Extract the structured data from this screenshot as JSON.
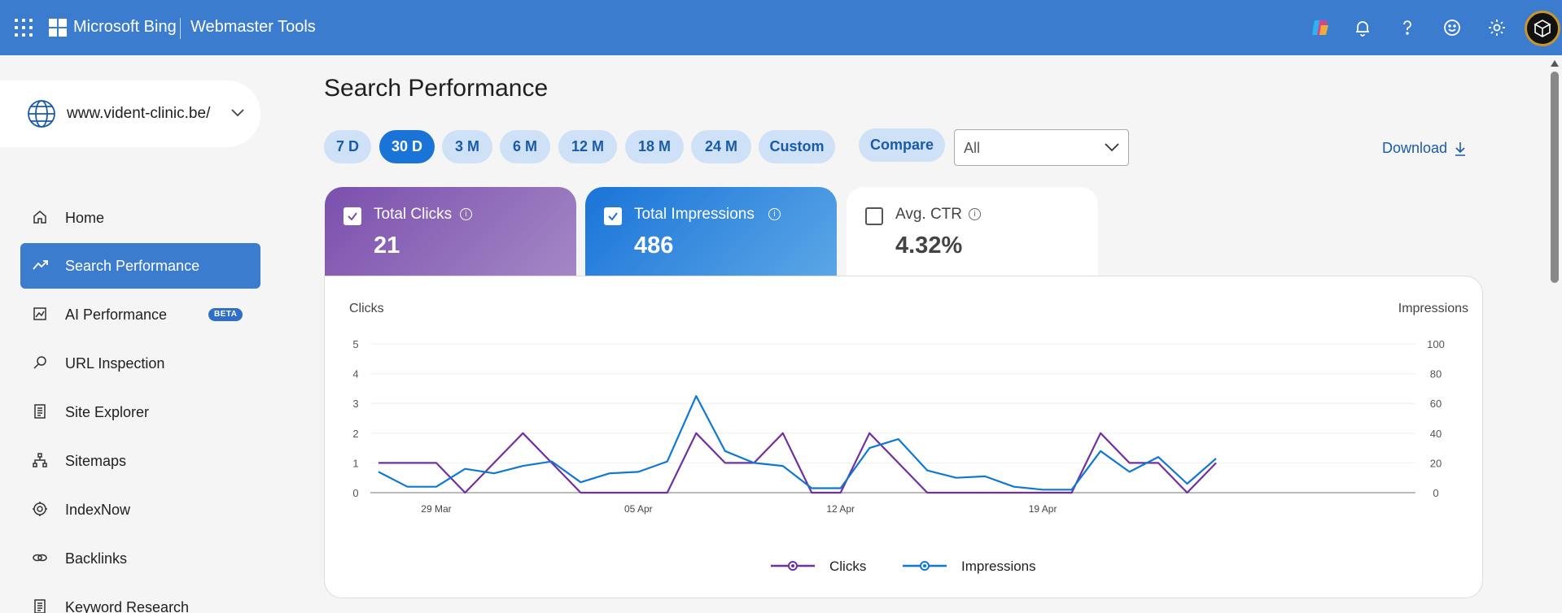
{
  "header": {
    "brand": "Microsoft Bing",
    "product": "Webmaster Tools",
    "icons": [
      "apps-icon",
      "copilot-icon",
      "bell-icon",
      "help-icon",
      "feedback-smiley-icon",
      "settings-gear-icon",
      "avatar"
    ]
  },
  "sidebar": {
    "site": "www.vident-clinic.be/",
    "items": [
      {
        "label": "Home",
        "icon": "home-icon"
      },
      {
        "label": "Search Performance",
        "icon": "trend-icon",
        "active": true
      },
      {
        "label": "AI Performance",
        "icon": "image-chart-icon",
        "badge": "BETA"
      },
      {
        "label": "URL Inspection",
        "icon": "search-icon"
      },
      {
        "label": "Site Explorer",
        "icon": "document-icon"
      },
      {
        "label": "Sitemaps",
        "icon": "sitemap-icon"
      },
      {
        "label": "IndexNow",
        "icon": "gear-icon"
      },
      {
        "label": "Backlinks",
        "icon": "link-icon"
      },
      {
        "label": "Keyword Research",
        "icon": "document-icon"
      }
    ]
  },
  "main": {
    "title": "Search Performance",
    "ranges": [
      "7 D",
      "30 D",
      "3 M",
      "6 M",
      "12 M",
      "18 M",
      "24 M",
      "Custom"
    ],
    "active_range": "30 D",
    "compare_label": "Compare",
    "filter_value": "All",
    "download_label": "Download"
  },
  "cards": {
    "clicks": {
      "label": "Total Clicks",
      "value": "21",
      "checked": true
    },
    "impressions": {
      "label": "Total Impressions",
      "value": "486",
      "checked": true
    },
    "ctr": {
      "label": "Avg. CTR",
      "value": "4.32%",
      "checked": false
    }
  },
  "colors": {
    "header": "#3c7ccf",
    "clicks": "#7030a0",
    "impressions": "#0f78d4",
    "active_chip": "#1a74d8"
  },
  "chart_data": {
    "type": "line",
    "ylabel": "Clicks",
    "y2label": "Impressions",
    "ylim": [
      0,
      5
    ],
    "y2lim": [
      0,
      100
    ],
    "yticks": [
      0,
      1,
      2,
      3,
      4,
      5
    ],
    "y2ticks": [
      0,
      20,
      40,
      60,
      80,
      100
    ],
    "x_tick_labels": [
      {
        "index": 2,
        "label": "29 Mar"
      },
      {
        "index": 9,
        "label": "05 Apr"
      },
      {
        "index": 16,
        "label": "12 Apr"
      },
      {
        "index": 23,
        "label": "19 Apr"
      }
    ],
    "series": [
      {
        "name": "Clicks",
        "axis": "left",
        "color": "#7030a0",
        "values": [
          1,
          1,
          1,
          0,
          1,
          2,
          1,
          0,
          0,
          0,
          0,
          2,
          1,
          1,
          2,
          0,
          0,
          2,
          1,
          0,
          0,
          0,
          0,
          0,
          0,
          2,
          1,
          1,
          0,
          1
        ]
      },
      {
        "name": "Impressions",
        "axis": "right",
        "color": "#0f78d4",
        "values": [
          14,
          4,
          4,
          16,
          13,
          18,
          21,
          7,
          13,
          14,
          21,
          65,
          28,
          20,
          18,
          3,
          3,
          30,
          36,
          15,
          10,
          11,
          4,
          2,
          2,
          28,
          14,
          24,
          6,
          23
        ]
      }
    ]
  }
}
